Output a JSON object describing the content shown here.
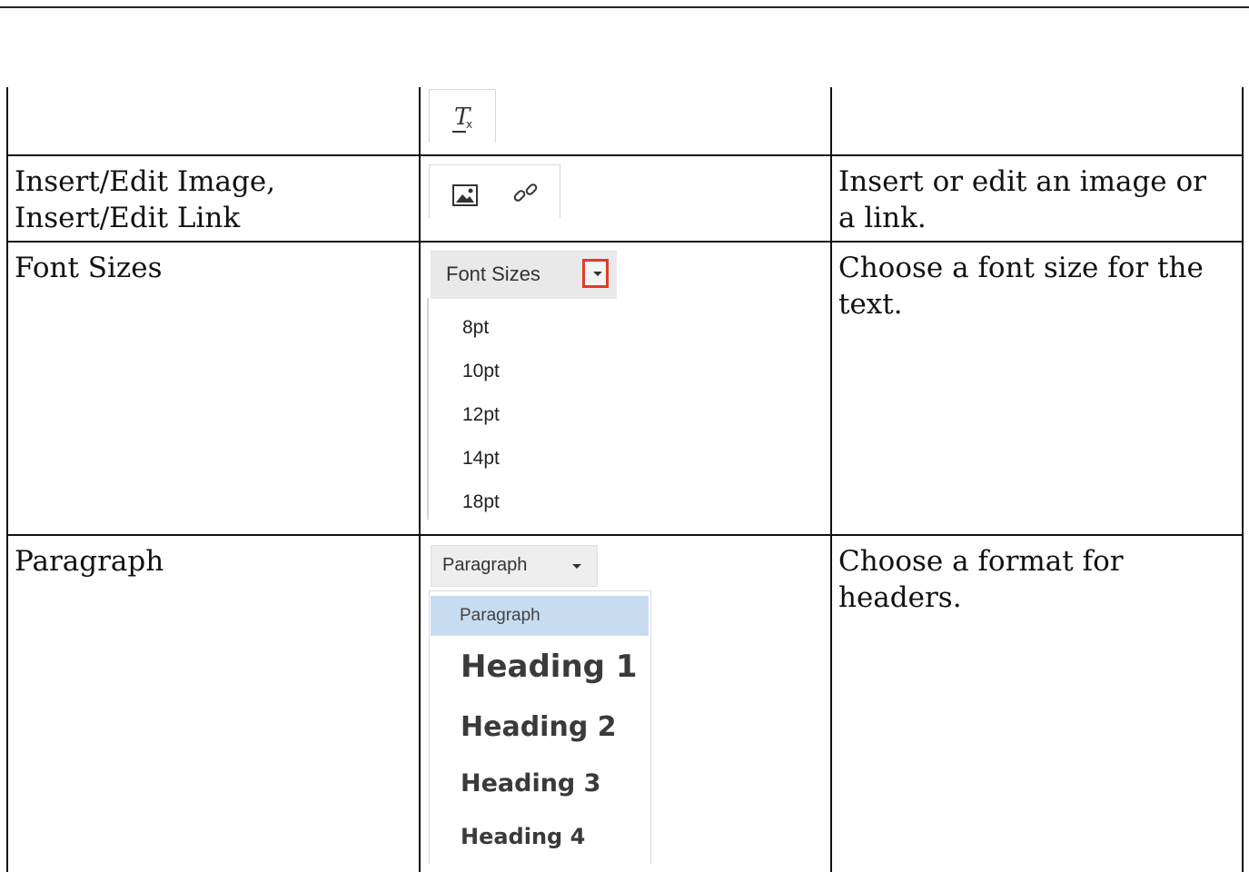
{
  "rows": [
    {
      "feature": "",
      "description": ""
    },
    {
      "feature": "Insert/Edit Image,\nInsert/Edit Link",
      "description": "Insert or edit an image or\na link."
    },
    {
      "feature": "Font Sizes",
      "description": "Choose a font size for the\ntext."
    },
    {
      "feature": "Paragraph",
      "description": "Choose a format for\nheaders."
    }
  ],
  "clear_format_icon": "remove-formatting-icon",
  "image_icon": "image-icon",
  "link_icon": "link-icon",
  "font_sizes": {
    "button_label": "Font Sizes",
    "options": [
      "8pt",
      "10pt",
      "12pt",
      "14pt",
      "18pt"
    ],
    "highlight_color": "#e23a2a"
  },
  "paragraph": {
    "button_label": "Paragraph",
    "options": [
      "Paragraph",
      "Heading 1",
      "Heading 2",
      "Heading 3",
      "Heading 4"
    ],
    "selected_color": "#c8dcf1"
  }
}
